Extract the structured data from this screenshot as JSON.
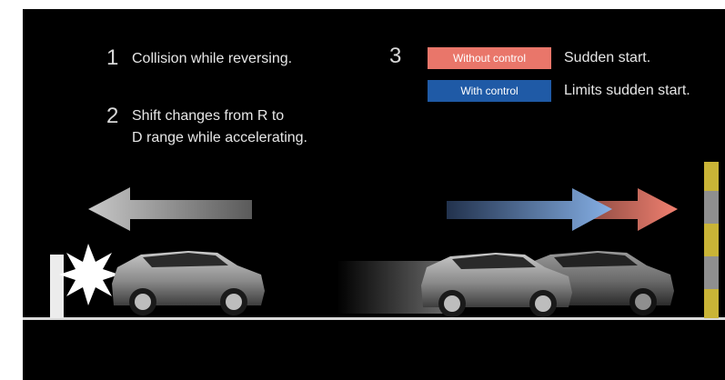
{
  "items": {
    "one": {
      "number": "1",
      "text": "Collision while reversing."
    },
    "two": {
      "number": "2",
      "line1": "Shift changes from R to",
      "line2": "D range while accelerating."
    },
    "three": {
      "number": "3",
      "without_label": "Without control",
      "without_desc": "Sudden start.",
      "with_label": "With control",
      "with_desc": "Limits sudden start."
    }
  },
  "colors": {
    "without": "#e9766a",
    "with": "#1f5aa6",
    "background": "#000000",
    "arrow_grey": "#b5b5b5",
    "arrow_blue": "#7da3d8",
    "arrow_red": "#e9766a",
    "pole_yellow": "#c9b437"
  },
  "icons": [
    "left-arrow-icon",
    "right-arrow-blue-icon",
    "right-arrow-red-icon",
    "collision-burst-icon",
    "car-icon",
    "pole-icon"
  ]
}
